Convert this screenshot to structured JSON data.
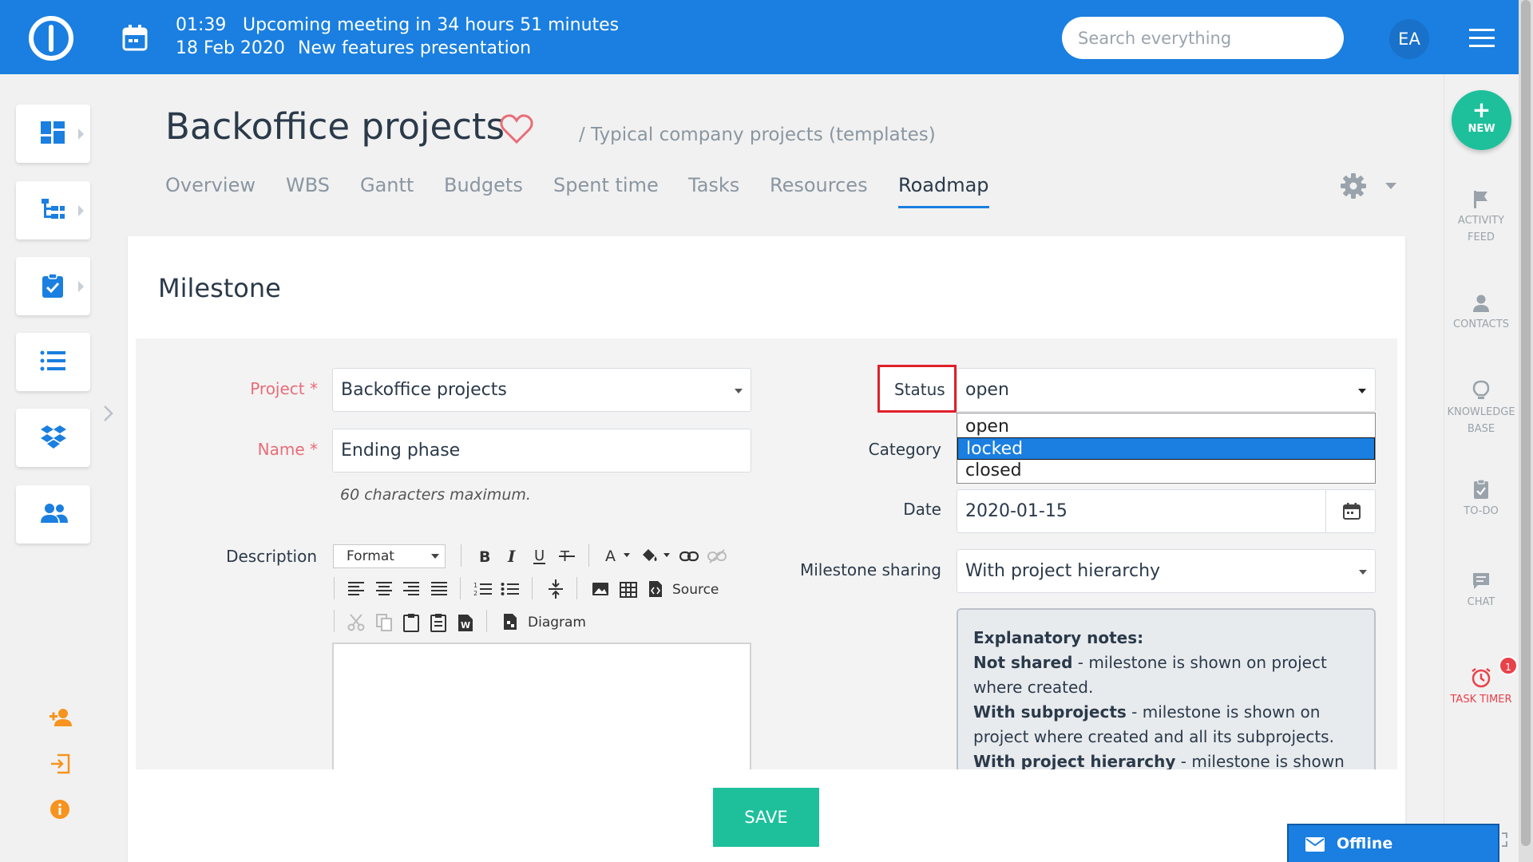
{
  "meeting": {
    "time": "01:39",
    "text": "Upcoming meeting in 34 hours 51 minutes",
    "date": "18 Feb 2020",
    "title": "New features presentation"
  },
  "search": {
    "placeholder": "Search everything"
  },
  "user": {
    "initials": "EA"
  },
  "project": {
    "title": "Backoffice projects",
    "breadcrumb": "/ Typical company projects (templates)"
  },
  "tabs": [
    "Overview",
    "WBS",
    "Gantt",
    "Budgets",
    "Spent time",
    "Tasks",
    "Resources",
    "Roadmap"
  ],
  "active_tab": "Roadmap",
  "page": {
    "title": "Milestone"
  },
  "form": {
    "project_label": "Project *",
    "project_value": "Backoffice projects",
    "name_label": "Name *",
    "name_value": "Ending phase",
    "name_hint": "60 characters maximum.",
    "description_label": "Description",
    "status_label": "Status",
    "status_value": "open",
    "status_options": [
      "open",
      "locked",
      "closed"
    ],
    "status_highlighted": "locked",
    "category_label": "Category",
    "date_label": "Date",
    "date_value": "2020-01-15",
    "sharing_label": "Milestone sharing",
    "sharing_value": "With project hierarchy"
  },
  "editor": {
    "format_label": "Format",
    "source_label": "Source",
    "diagram_label": "Diagram"
  },
  "notes": {
    "title": "Explanatory notes:",
    "items": [
      {
        "term": "Not shared",
        "desc": " - milestone is shown on project where created."
      },
      {
        "term": "With subprojects",
        "desc": " - milestone is shown on project where created and all its subprojects."
      },
      {
        "term": "With project hierarchy",
        "desc": " - milestone is shown on"
      }
    ]
  },
  "save_label": "SAVE",
  "right_rail": {
    "new_label": "NEW",
    "activity_feed": [
      "ACTIVITY",
      "FEED"
    ],
    "contacts": "CONTACTS",
    "knowledge_base": [
      "KNOWLEDGE",
      "BASE"
    ],
    "todo": "TO-DO",
    "chat": "CHAT",
    "task_timer": "TASK TIMER",
    "task_timer_badge": "1"
  },
  "chat_widget": {
    "status": "Offline"
  },
  "colors": {
    "topbar": "#1a7fe0",
    "accent_green": "#1dc09b",
    "required": "#e86d78",
    "highlight_red": "#e0202a"
  }
}
